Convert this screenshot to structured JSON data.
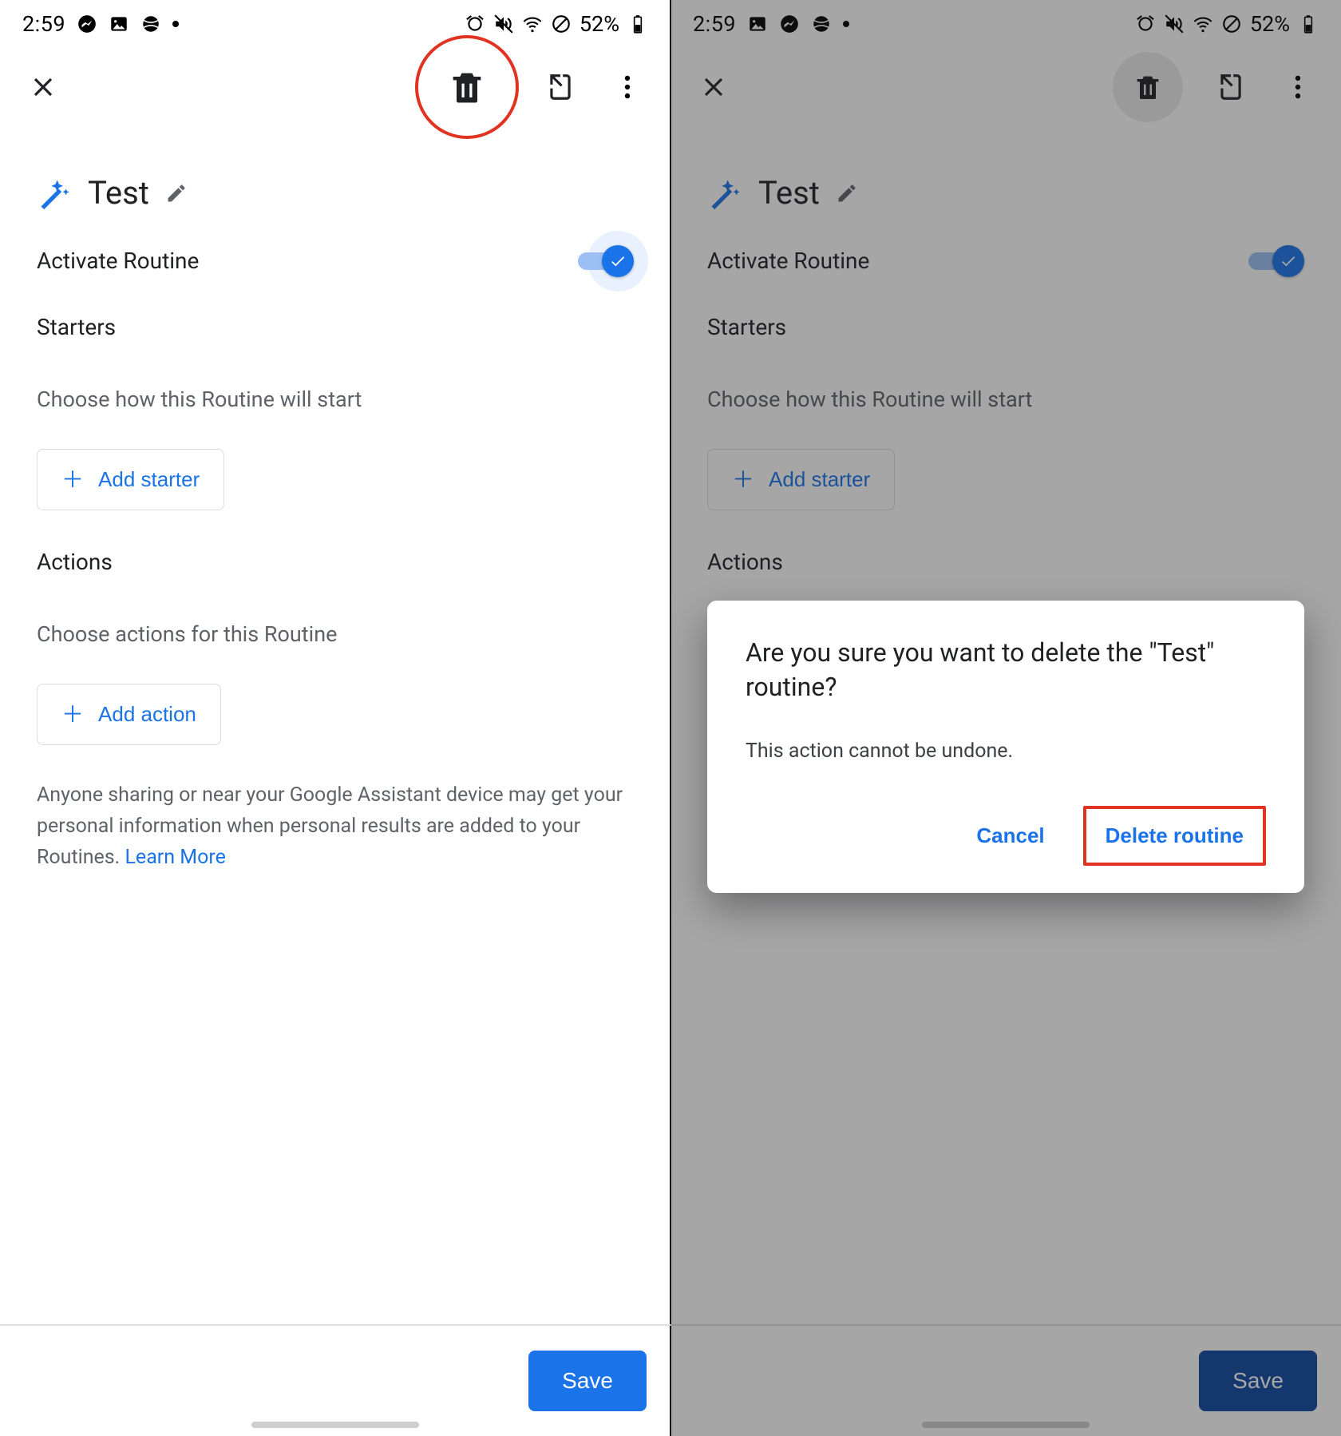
{
  "status_bar": {
    "time": "2:59",
    "battery_pct": "52%"
  },
  "routine": {
    "title": "Test",
    "activate_label": "Activate Routine",
    "starters_heading": "Starters",
    "starters_sub": "Choose how this Routine will start",
    "add_starter_label": "Add starter",
    "actions_heading": "Actions",
    "actions_sub": "Choose actions for this Routine",
    "add_action_label": "Add action",
    "disclaimer_text": "Anyone sharing or near your Google Assistant device may get your personal information when personal results are added to your Routines. ",
    "learn_more": "Learn More",
    "save_label": "Save"
  },
  "dialog": {
    "title": "Are you sure you want to delete the \"Test\" routine?",
    "body": "This action cannot be undone.",
    "cancel": "Cancel",
    "confirm": "Delete routine"
  }
}
